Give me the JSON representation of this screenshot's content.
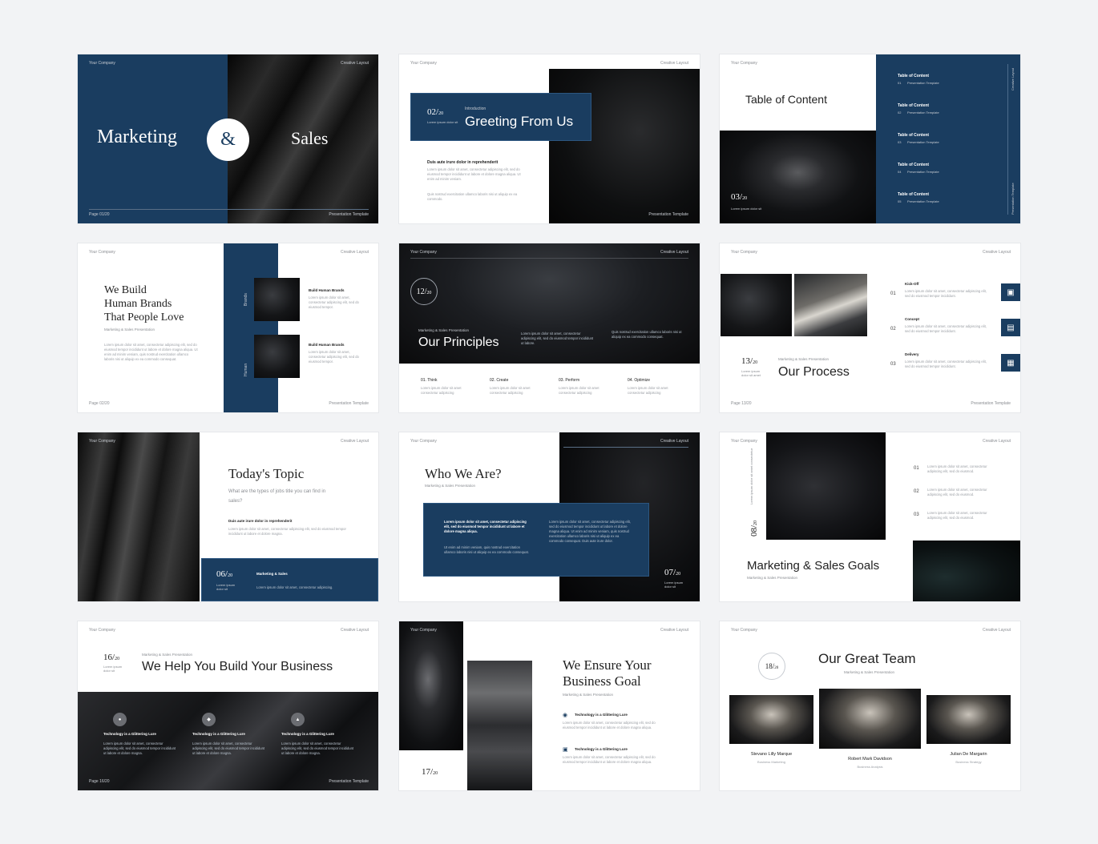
{
  "common": {
    "company": "Your Company",
    "layout": "Creative Layout",
    "template": "Presentation Template"
  },
  "s1": {
    "left": "Marketing",
    "amp": "&",
    "right": "Sales",
    "page": "Page 01/20"
  },
  "s2": {
    "num": "02/",
    "den": "20",
    "kicker": "Introduction",
    "title": "Greeting From Us",
    "sub": "Lorem ipsum dolor sit",
    "head": "Duis aute irure dolor in reprehenderit",
    "body": "Lorem ipsum dolor sit amet, consectetur adipiscing elit, sed do eiusmod tempor incididunt ut labore et dolore magna aliqua. Ut enim ad minim veniam.",
    "body2": "Quis nostrud exercitation ullamco laboris nisi ut aliquip ex ea commodo."
  },
  "s3": {
    "title": "Table of Content",
    "num": "03/",
    "den": "20",
    "sub": "Lorem ipsum dolor sit",
    "items": [
      {
        "t": "Table of Content",
        "n": "01",
        "s": "Presentation Template"
      },
      {
        "t": "Table of Content",
        "n": "02",
        "s": "Presentation Template"
      },
      {
        "t": "Table of Content",
        "n": "03",
        "s": "Presentation Template"
      },
      {
        "t": "Table of Content",
        "n": "04",
        "s": "Presentation Template"
      },
      {
        "t": "Table of Content",
        "n": "05",
        "s": "Presentation Template"
      }
    ],
    "vtop": "Creative Layout",
    "vbot": "Presentation Template"
  },
  "s4": {
    "title1": "We Build",
    "title2": "Human Brands",
    "title3": "That People Love",
    "sub": "Marketing & Sales Presentation",
    "body": "Lorem ipsum dolor sit amet, consectetur adipiscing elit, sed do eiusmod tempor incididunt ut labore et dolore magna aliqua. Ut enim ad minim veniam, quis nostrud exercitation ullamco laboris nisi ut aliquip ex ea commodo consequat.",
    "b1": "Build Human Brands",
    "b2": "Build Human Brands",
    "bt": "Lorem ipsum dolor sit amet, consectetur adipiscing elit, sed do eiusmod tempor.",
    "v1": "Brands",
    "v2": "Human",
    "page": "Page 02/20"
  },
  "s5": {
    "num": "12/",
    "den": "20",
    "kicker": "Marketing & Sales Presentation",
    "title": "Our Principles",
    "p1": "Lorem ipsum dolor sit amet, consectetur adipiscing elit, sed do eiusmod tempor incididunt ut labore.",
    "p2": "Quis nostrud exercitation ullamco laboris nisi ut aliquip ex ea commodo consequat.",
    "cols": [
      {
        "t": "01. Think",
        "d": "Lorem ipsum dolor sit amet consectetur adipiscing"
      },
      {
        "t": "02. Create",
        "d": "Lorem ipsum dolor sit amet consectetur adipiscing"
      },
      {
        "t": "03. Perform",
        "d": "Lorem ipsum dolor sit amet consectetur adipiscing"
      },
      {
        "t": "04. Optimize",
        "d": "Lorem ipsum dolor sit amet consectetur adipiscing"
      }
    ]
  },
  "s6": {
    "num": "13/",
    "den": "20",
    "sub": "Lorem ipsum dolor sit amet",
    "kicker": "Marketing & Sales Presentation",
    "title": "Our Process",
    "steps": [
      {
        "n": "01",
        "t": "Kick-Off",
        "d": "Lorem ipsum dolor sit amet, consectetur adipiscing elit, sed do eiusmod tempor incididunt."
      },
      {
        "n": "02",
        "t": "Concept",
        "d": "Lorem ipsum dolor sit amet, consectetur adipiscing elit, sed do eiusmod tempor incididunt."
      },
      {
        "n": "03",
        "t": "Delivery",
        "d": "Lorem ipsum dolor sit amet, consectetur adipiscing elit, sed do eiusmod tempor incididunt."
      }
    ],
    "page": "Page 13/20"
  },
  "s7": {
    "title": "Today's Topic",
    "q": "What are the types of jobs title you can find in sales?",
    "head": "Duis aute irure dolor in reprehenderit",
    "body": "Lorem ipsum dolor sit amet, consectetur adipiscing elit, sed do eiusmod tempor incididunt ut labore et dolore magna.",
    "num": "06/",
    "den": "20",
    "bsub": "Lorem ipsum dolor sit",
    "bt": "Marketing & Sales",
    "bd": "Lorem ipsum dolor sit amet, consectetur adipiscing."
  },
  "s8": {
    "title": "Who We Are?",
    "sub": "Marketing & Sales Presentation",
    "c1": "Lorem ipsum dolor sit amet, consectetur adipiscing elit, sed do eiusmod tempor incididunt ut labore et dolore magna aliqua.",
    "c2": "Ut enim ad minim veniam, quis nostrud exercitation ullamco laboris nisi ut aliquip ex ea commodo consequat.",
    "c3": "Lorem ipsum dolor sit amet, consectetur adipiscing elit, sed do eiusmod tempor incididunt ut labore et dolore magna aliqua. Ut enim ad minim veniam, quis nostrud exercitation ullamco laboris nisi ut aliquip ex ea commodo consequat. Duis aute irure dolor.",
    "num": "07/",
    "den": "20",
    "nsub": "Lorem ipsum dolor sit"
  },
  "s9": {
    "num": "08/",
    "den": "20",
    "vsub": "Lorem ipsum dolor sit amet consectetur",
    "title": "Marketing & Sales Goals",
    "sub": "Marketing & Sales Presentation",
    "items": [
      {
        "n": "01",
        "d": "Lorem ipsum dolor sit amet, consectetur adipiscing elit, sed do eiusmod."
      },
      {
        "n": "02",
        "d": "Lorem ipsum dolor sit amet, consectetur adipiscing elit, sed do eiusmod."
      },
      {
        "n": "03",
        "d": "Lorem ipsum dolor sit amet, consectetur adipiscing elit, sed do eiusmod."
      }
    ]
  },
  "s10": {
    "num": "16/",
    "den": "20",
    "nsub": "Lorem ipsum dolor sit",
    "kicker": "Marketing & Sales Presentation",
    "title": "We Help You Build Your Business",
    "cols": [
      {
        "t": "Technology is a Glittering Lure",
        "d": "Lorem ipsum dolor sit amet, consectetur adipiscing elit, sed do eiusmod tempor incididunt ut labore et dolore magna."
      },
      {
        "t": "Technology is a Glittering Lure",
        "d": "Lorem ipsum dolor sit amet, consectetur adipiscing elit, sed do eiusmod tempor incididunt ut labore et dolore magna."
      },
      {
        "t": "Technology is a Glittering Lure",
        "d": "Lorem ipsum dolor sit amet, consectetur adipiscing elit, sed do eiusmod tempor incididunt ut labore et dolore magna."
      }
    ],
    "page": "Page 16/20"
  },
  "s11": {
    "num": "17/",
    "den": "20",
    "title1": "We Ensure Your",
    "title2": "Business Goal",
    "sub": "Marketing & Sales Presentation",
    "items": [
      {
        "t": "Technology is a Glittering Lure",
        "d": "Lorem ipsum dolor sit amet, consectetur adipiscing elit, sed do eiusmod tempor incididunt ut labore et dolore magna aliqua."
      },
      {
        "t": "Technology is a Glittering Lure",
        "d": "Lorem ipsum dolor sit amet, consectetur adipiscing elit, sed do eiusmod tempor incididunt ut labore et dolore magna aliqua."
      }
    ]
  },
  "s12": {
    "num": "18/",
    "den": "20",
    "title": "Our Great Team",
    "sub": "Marketing & Sales Presentation",
    "team": [
      {
        "n": "Stevano Lilly Marque",
        "r": "Business Marketing"
      },
      {
        "n": "Robert Mark Davidson",
        "r": "Business Analysis"
      },
      {
        "n": "Julian De Margarin",
        "r": "Business Strategy"
      }
    ]
  }
}
